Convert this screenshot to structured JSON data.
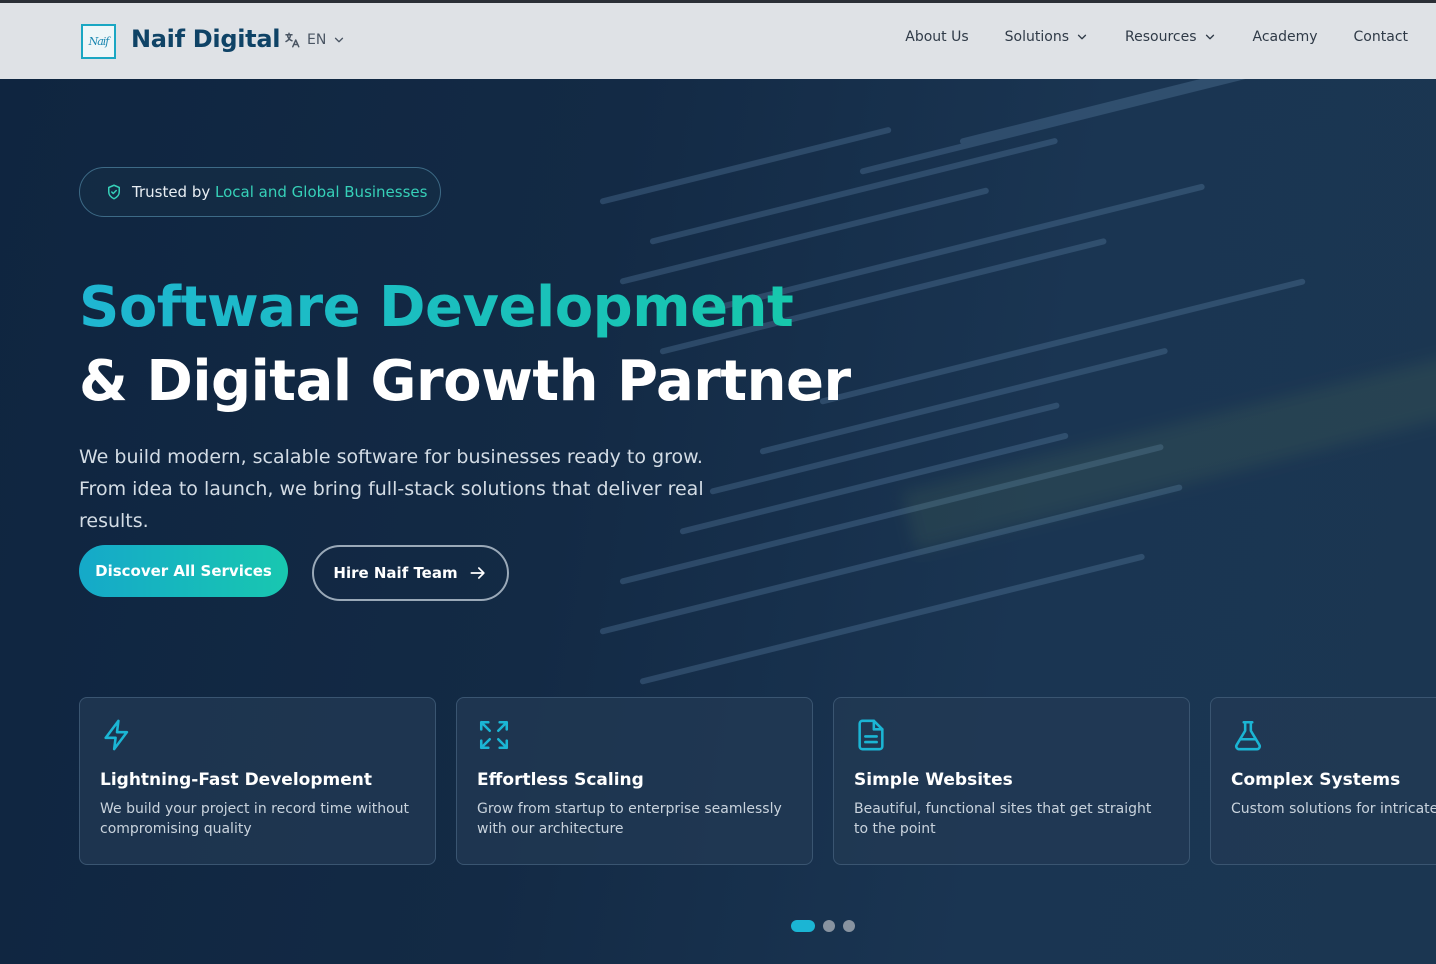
{
  "header": {
    "logo_text": "Naif Digital",
    "logo_mark": "Naif",
    "lang_label": "EN",
    "nav": [
      {
        "label": "About Us"
      },
      {
        "label": "Solutions"
      },
      {
        "label": "Resources"
      },
      {
        "label": "Academy"
      },
      {
        "label": "Contact"
      }
    ]
  },
  "hero": {
    "badge_prefix": "Trusted by ",
    "badge_highlight": "Local and Global Businesses",
    "title_line1": "Software Development",
    "title_line2": "& Digital Growth Partner",
    "lead": "We build modern, scalable software for businesses ready to grow. From idea to launch, we bring full-stack solutions that deliver real results.",
    "primary_button": "Discover All Services",
    "secondary_button": "Hire Naif Team"
  },
  "features": [
    {
      "title": "Lightning-Fast Development",
      "desc": "We build your project in record time without compromising quality",
      "icon": "lightning-icon"
    },
    {
      "title": "Effortless Scaling",
      "desc": "Grow from startup to enterprise seamlessly with our architecture",
      "icon": "expand-icon"
    },
    {
      "title": "Simple Websites",
      "desc": "Beautiful, functional sites that get straight to the point",
      "icon": "document-icon"
    },
    {
      "title": "Complex Systems",
      "desc": "Custom solutions for intricate bu",
      "icon": "flask-icon"
    }
  ],
  "carousel": {
    "pages": 3,
    "active": 0
  },
  "colors": {
    "accent": "#1bb5d4",
    "accent2": "#16c9a9",
    "header_bg": "#dfe2e6",
    "hero_bg": "#132a45"
  }
}
